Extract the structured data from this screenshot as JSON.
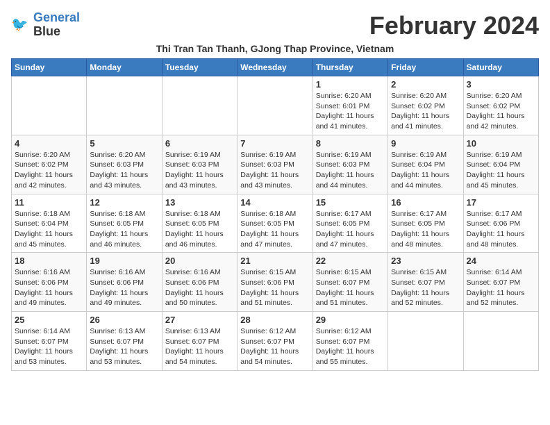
{
  "logo": {
    "line1": "General",
    "line2": "Blue"
  },
  "title": "February 2024",
  "subtitle": "Thi Tran Tan Thanh, GJong Thap Province, Vietnam",
  "days_of_week": [
    "Sunday",
    "Monday",
    "Tuesday",
    "Wednesday",
    "Thursday",
    "Friday",
    "Saturday"
  ],
  "weeks": [
    [
      {
        "day": "",
        "sunrise": "",
        "sunset": "",
        "daylight": ""
      },
      {
        "day": "",
        "sunrise": "",
        "sunset": "",
        "daylight": ""
      },
      {
        "day": "",
        "sunrise": "",
        "sunset": "",
        "daylight": ""
      },
      {
        "day": "",
        "sunrise": "",
        "sunset": "",
        "daylight": ""
      },
      {
        "day": "1",
        "sunrise": "Sunrise: 6:20 AM",
        "sunset": "Sunset: 6:01 PM",
        "daylight": "Daylight: 11 hours and 41 minutes."
      },
      {
        "day": "2",
        "sunrise": "Sunrise: 6:20 AM",
        "sunset": "Sunset: 6:02 PM",
        "daylight": "Daylight: 11 hours and 41 minutes."
      },
      {
        "day": "3",
        "sunrise": "Sunrise: 6:20 AM",
        "sunset": "Sunset: 6:02 PM",
        "daylight": "Daylight: 11 hours and 42 minutes."
      }
    ],
    [
      {
        "day": "4",
        "sunrise": "Sunrise: 6:20 AM",
        "sunset": "Sunset: 6:02 PM",
        "daylight": "Daylight: 11 hours and 42 minutes."
      },
      {
        "day": "5",
        "sunrise": "Sunrise: 6:20 AM",
        "sunset": "Sunset: 6:03 PM",
        "daylight": "Daylight: 11 hours and 43 minutes."
      },
      {
        "day": "6",
        "sunrise": "Sunrise: 6:19 AM",
        "sunset": "Sunset: 6:03 PM",
        "daylight": "Daylight: 11 hours and 43 minutes."
      },
      {
        "day": "7",
        "sunrise": "Sunrise: 6:19 AM",
        "sunset": "Sunset: 6:03 PM",
        "daylight": "Daylight: 11 hours and 43 minutes."
      },
      {
        "day": "8",
        "sunrise": "Sunrise: 6:19 AM",
        "sunset": "Sunset: 6:03 PM",
        "daylight": "Daylight: 11 hours and 44 minutes."
      },
      {
        "day": "9",
        "sunrise": "Sunrise: 6:19 AM",
        "sunset": "Sunset: 6:04 PM",
        "daylight": "Daylight: 11 hours and 44 minutes."
      },
      {
        "day": "10",
        "sunrise": "Sunrise: 6:19 AM",
        "sunset": "Sunset: 6:04 PM",
        "daylight": "Daylight: 11 hours and 45 minutes."
      }
    ],
    [
      {
        "day": "11",
        "sunrise": "Sunrise: 6:18 AM",
        "sunset": "Sunset: 6:04 PM",
        "daylight": "Daylight: 11 hours and 45 minutes."
      },
      {
        "day": "12",
        "sunrise": "Sunrise: 6:18 AM",
        "sunset": "Sunset: 6:05 PM",
        "daylight": "Daylight: 11 hours and 46 minutes."
      },
      {
        "day": "13",
        "sunrise": "Sunrise: 6:18 AM",
        "sunset": "Sunset: 6:05 PM",
        "daylight": "Daylight: 11 hours and 46 minutes."
      },
      {
        "day": "14",
        "sunrise": "Sunrise: 6:18 AM",
        "sunset": "Sunset: 6:05 PM",
        "daylight": "Daylight: 11 hours and 47 minutes."
      },
      {
        "day": "15",
        "sunrise": "Sunrise: 6:17 AM",
        "sunset": "Sunset: 6:05 PM",
        "daylight": "Daylight: 11 hours and 47 minutes."
      },
      {
        "day": "16",
        "sunrise": "Sunrise: 6:17 AM",
        "sunset": "Sunset: 6:05 PM",
        "daylight": "Daylight: 11 hours and 48 minutes."
      },
      {
        "day": "17",
        "sunrise": "Sunrise: 6:17 AM",
        "sunset": "Sunset: 6:06 PM",
        "daylight": "Daylight: 11 hours and 48 minutes."
      }
    ],
    [
      {
        "day": "18",
        "sunrise": "Sunrise: 6:16 AM",
        "sunset": "Sunset: 6:06 PM",
        "daylight": "Daylight: 11 hours and 49 minutes."
      },
      {
        "day": "19",
        "sunrise": "Sunrise: 6:16 AM",
        "sunset": "Sunset: 6:06 PM",
        "daylight": "Daylight: 11 hours and 49 minutes."
      },
      {
        "day": "20",
        "sunrise": "Sunrise: 6:16 AM",
        "sunset": "Sunset: 6:06 PM",
        "daylight": "Daylight: 11 hours and 50 minutes."
      },
      {
        "day": "21",
        "sunrise": "Sunrise: 6:15 AM",
        "sunset": "Sunset: 6:06 PM",
        "daylight": "Daylight: 11 hours and 51 minutes."
      },
      {
        "day": "22",
        "sunrise": "Sunrise: 6:15 AM",
        "sunset": "Sunset: 6:07 PM",
        "daylight": "Daylight: 11 hours and 51 minutes."
      },
      {
        "day": "23",
        "sunrise": "Sunrise: 6:15 AM",
        "sunset": "Sunset: 6:07 PM",
        "daylight": "Daylight: 11 hours and 52 minutes."
      },
      {
        "day": "24",
        "sunrise": "Sunrise: 6:14 AM",
        "sunset": "Sunset: 6:07 PM",
        "daylight": "Daylight: 11 hours and 52 minutes."
      }
    ],
    [
      {
        "day": "25",
        "sunrise": "Sunrise: 6:14 AM",
        "sunset": "Sunset: 6:07 PM",
        "daylight": "Daylight: 11 hours and 53 minutes."
      },
      {
        "day": "26",
        "sunrise": "Sunrise: 6:13 AM",
        "sunset": "Sunset: 6:07 PM",
        "daylight": "Daylight: 11 hours and 53 minutes."
      },
      {
        "day": "27",
        "sunrise": "Sunrise: 6:13 AM",
        "sunset": "Sunset: 6:07 PM",
        "daylight": "Daylight: 11 hours and 54 minutes."
      },
      {
        "day": "28",
        "sunrise": "Sunrise: 6:12 AM",
        "sunset": "Sunset: 6:07 PM",
        "daylight": "Daylight: 11 hours and 54 minutes."
      },
      {
        "day": "29",
        "sunrise": "Sunrise: 6:12 AM",
        "sunset": "Sunset: 6:07 PM",
        "daylight": "Daylight: 11 hours and 55 minutes."
      },
      {
        "day": "",
        "sunrise": "",
        "sunset": "",
        "daylight": ""
      },
      {
        "day": "",
        "sunrise": "",
        "sunset": "",
        "daylight": ""
      }
    ]
  ]
}
